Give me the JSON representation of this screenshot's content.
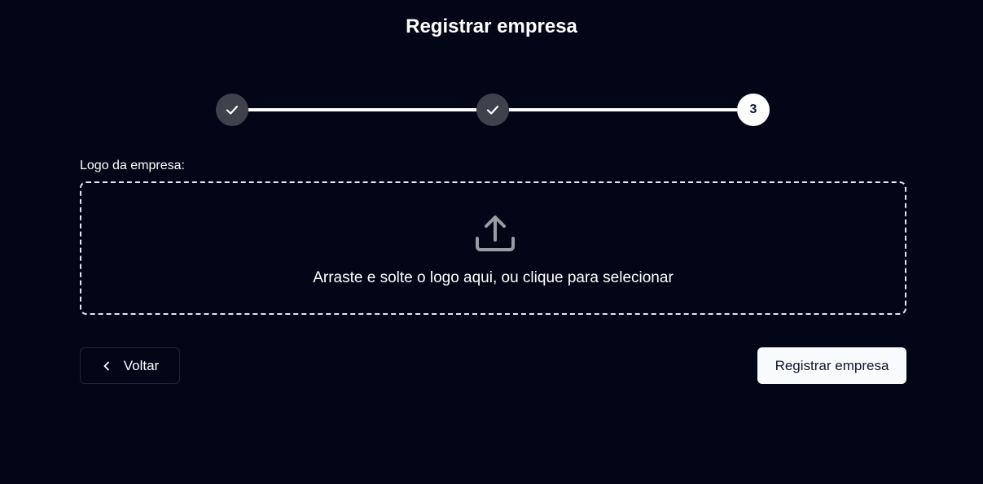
{
  "header": {
    "title": "Registrar empresa"
  },
  "stepper": {
    "steps": [
      {
        "state": "completed",
        "icon": "check-icon"
      },
      {
        "state": "completed",
        "icon": "check-icon"
      },
      {
        "state": "current",
        "label": "3"
      }
    ]
  },
  "upload": {
    "label": "Logo da empresa:",
    "icon": "upload-icon",
    "instruction": "Arraste e solte o logo aqui, ou clique para selecionar"
  },
  "actions": {
    "back_label": "Voltar",
    "back_icon": "chevron-left-icon",
    "submit_label": "Registrar empresa"
  },
  "colors": {
    "background": "#030617",
    "completed_step": "#3f414d",
    "accent": "#ffffff"
  }
}
